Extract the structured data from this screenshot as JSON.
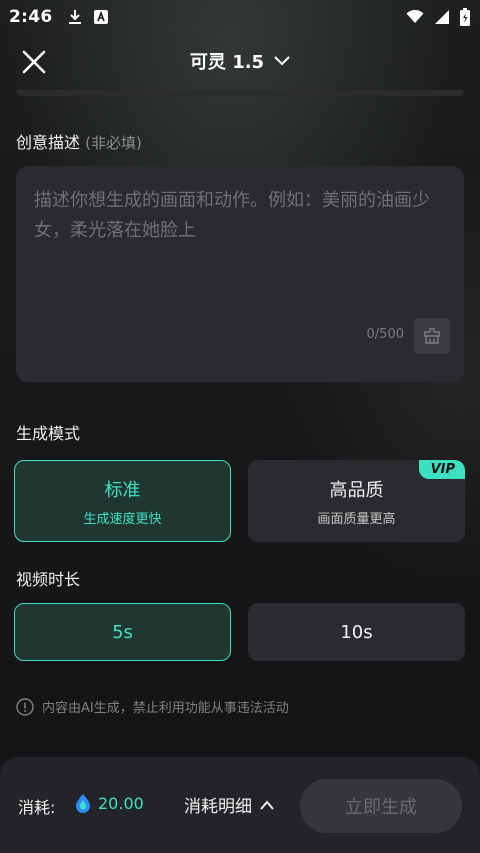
{
  "status_bar": {
    "time": "2:46"
  },
  "header": {
    "title": "可灵 1.5"
  },
  "description": {
    "label": "创意描述",
    "label_hint": "(非必填)",
    "placeholder": "描述你想生成的画面和动作。例如：美丽的油画少女，柔光落在她脸上",
    "char_count": "0/500"
  },
  "mode": {
    "label": "生成模式",
    "options": [
      {
        "title": "标准",
        "subtitle": "生成速度更快",
        "selected": true
      },
      {
        "title": "高品质",
        "subtitle": "画面质量更高",
        "badge": "VIP",
        "selected": false
      }
    ]
  },
  "duration": {
    "label": "视频时长",
    "options": [
      {
        "label": "5s",
        "selected": true
      },
      {
        "label": "10s",
        "selected": false
      }
    ]
  },
  "notice": "内容由AI生成，禁止利用功能从事违法活动",
  "footer": {
    "cost_label": "消耗:",
    "cost_value": "20.00",
    "detail_label": "消耗明细",
    "generate_label": "立即生成"
  },
  "colors": {
    "accent": "#3ee0c2",
    "background": "#17181a",
    "card": "#2a2b2e"
  },
  "icons": [
    "download-icon",
    "a-badge-icon",
    "wifi-icon",
    "signal-icon",
    "battery-icon",
    "close-icon",
    "chevron-down-icon",
    "clear-icon",
    "info-icon",
    "energy-icon",
    "chevron-up-icon"
  ]
}
